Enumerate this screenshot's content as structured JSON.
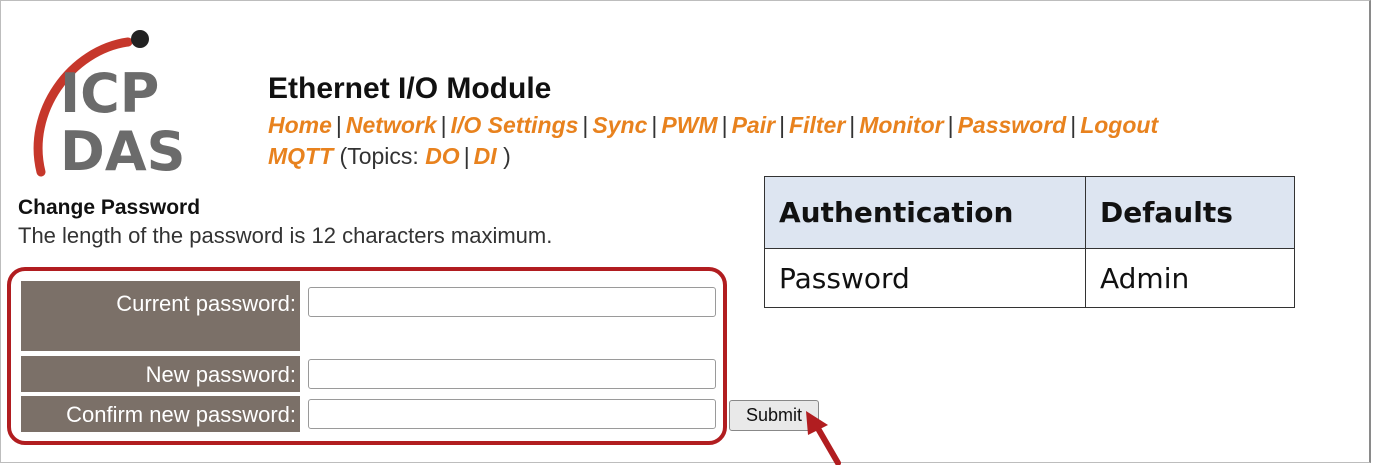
{
  "logo": {
    "line1": "ICP",
    "line2": "DAS"
  },
  "header": {
    "title": "Ethernet I/O Module"
  },
  "nav": {
    "items": [
      "Home",
      "Network",
      "I/O Settings",
      "Sync",
      "PWM",
      "Pair",
      "Filter",
      "Monitor",
      "Password",
      "Logout"
    ],
    "mqtt": {
      "label": "MQTT",
      "topics_prefix": "(Topics:",
      "topics": [
        "DO",
        "DI"
      ],
      "topics_suffix": ")"
    },
    "link_color": "#e8821e"
  },
  "change_password": {
    "title": "Change Password",
    "description": "The length of the password is 12 characters maximum.",
    "fields": [
      {
        "label": "Current password:",
        "value": ""
      },
      {
        "label": "New password:",
        "value": ""
      },
      {
        "label": "Confirm new password:",
        "value": ""
      }
    ],
    "submit_label": "Submit"
  },
  "defaults_table": {
    "headers": [
      "Authentication",
      "Defaults"
    ],
    "rows": [
      [
        "Password",
        "Admin"
      ]
    ]
  },
  "colors": {
    "label_bg": "#7b7068",
    "highlight_outline": "#b11d20",
    "table_header_bg": "#dde5f1",
    "logo_gray": "#6b6b6b",
    "logo_red": "#c6372b"
  }
}
